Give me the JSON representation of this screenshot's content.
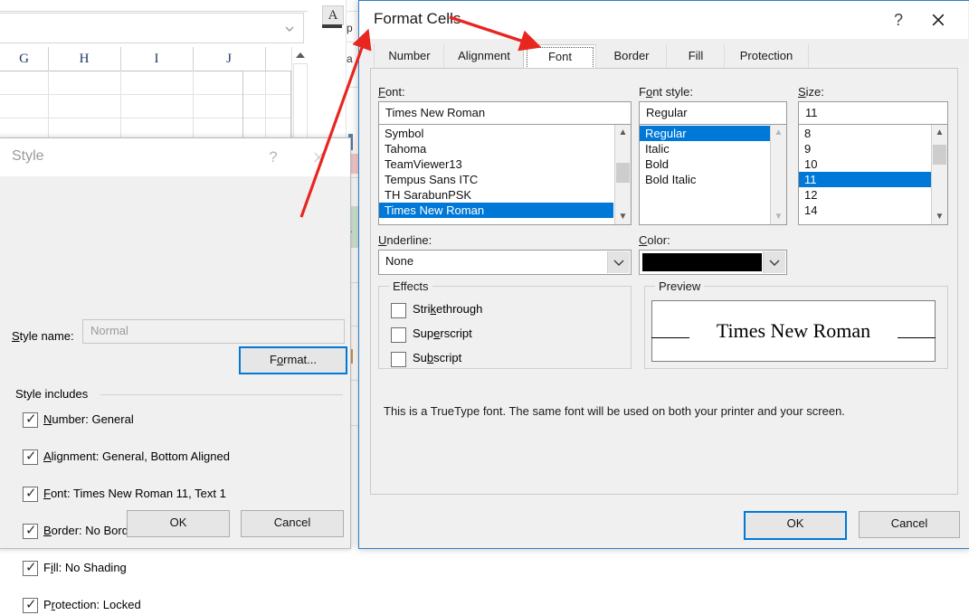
{
  "excel": {
    "column_headers": [
      "G",
      "H",
      "I",
      "J"
    ],
    "formula_bar_value": "",
    "font_color_button": "A",
    "icons": {
      "formula_chevron": "chevron-down-icon",
      "scroll_up": "scroll-up-arrow-icon",
      "font_color_caret": "caret-down-icon"
    }
  },
  "style_dialog": {
    "title": "Style",
    "help_label": "?",
    "close_label": "✕",
    "style_name_label": "Style name:",
    "style_name_value": "Normal",
    "format_button": "Format...",
    "style_includes_label": "Style includes",
    "includes": [
      {
        "accel": "N",
        "rest": "umber: General",
        "checked": true
      },
      {
        "accel": "A",
        "rest": "lignment: General, Bottom Aligned",
        "checked": true
      },
      {
        "accel": "F",
        "rest": "ont: Times New Roman 11, Text 1",
        "checked": true
      },
      {
        "accel": "B",
        "rest": "order: No Borders",
        "checked": true
      },
      {
        "accel": "i",
        "pre": "F",
        "rest": "ll: No Shading",
        "checked": true
      },
      {
        "accel": "r",
        "pre": "P",
        "rest": "otection: Locked",
        "checked": true
      }
    ],
    "ok_label": "OK",
    "cancel_label": "Cancel",
    "checkmark": "✓"
  },
  "format_cells": {
    "title": "Format Cells",
    "help_label": "?",
    "close_label": "✕",
    "tabs": [
      {
        "label": "Number",
        "active": false
      },
      {
        "label": "Alignment",
        "active": false
      },
      {
        "label": "Font",
        "active": true
      },
      {
        "label": "Border",
        "active": false
      },
      {
        "label": "Fill",
        "active": false
      },
      {
        "label": "Protection",
        "active": false
      }
    ],
    "font": {
      "label_accel": "F",
      "label_rest": "ont:",
      "value": "Times New Roman",
      "options": [
        "Symbol",
        "Tahoma",
        "TeamViewer13",
        "Tempus Sans ITC",
        "TH SarabunPSK",
        "Times New Roman"
      ],
      "selected": "Times New Roman"
    },
    "font_style": {
      "label_pre": "F",
      "label_accel": "o",
      "label_rest": "nt style:",
      "value": "Regular",
      "options": [
        "Regular",
        "Italic",
        "Bold",
        "Bold Italic"
      ],
      "selected": "Regular"
    },
    "size": {
      "label_accel": "S",
      "label_rest": "ize:",
      "value": "11",
      "options": [
        "8",
        "9",
        "10",
        "11",
        "12",
        "14"
      ],
      "selected": "11"
    },
    "underline": {
      "label_accel": "U",
      "label_rest": "nderline:",
      "value": "None"
    },
    "color": {
      "label_accel": "C",
      "label_rest": "olor:",
      "value_hex": "#000000"
    },
    "effects": {
      "group_title": "Effects",
      "items": [
        {
          "pre": "Stri",
          "accel": "k",
          "rest": "ethrough",
          "checked": false
        },
        {
          "pre": "Sup",
          "accel": "e",
          "rest": "rscript",
          "checked": false
        },
        {
          "pre": "Su",
          "accel": "b",
          "rest": "script",
          "checked": false
        }
      ]
    },
    "preview": {
      "group_title": "Preview",
      "text": "Times New Roman"
    },
    "truetype_message": "This is a TrueType font.  The same font will be used on both your printer and your screen.",
    "ok_label": "OK",
    "cancel_label": "Cancel"
  },
  "annotations": {
    "arrow_color": "#e8251f",
    "arrow_format_to_dialog": "arrow pointing from Format... button to Format Cells dialog",
    "arrow_to_font_tab": "arrow pointing to Font tab"
  },
  "colors": {
    "accent_blue": "#0078d7",
    "selection_blue": "#0078d7",
    "dialog_face": "#f0f0f0",
    "arrow_red": "#e8251f"
  }
}
